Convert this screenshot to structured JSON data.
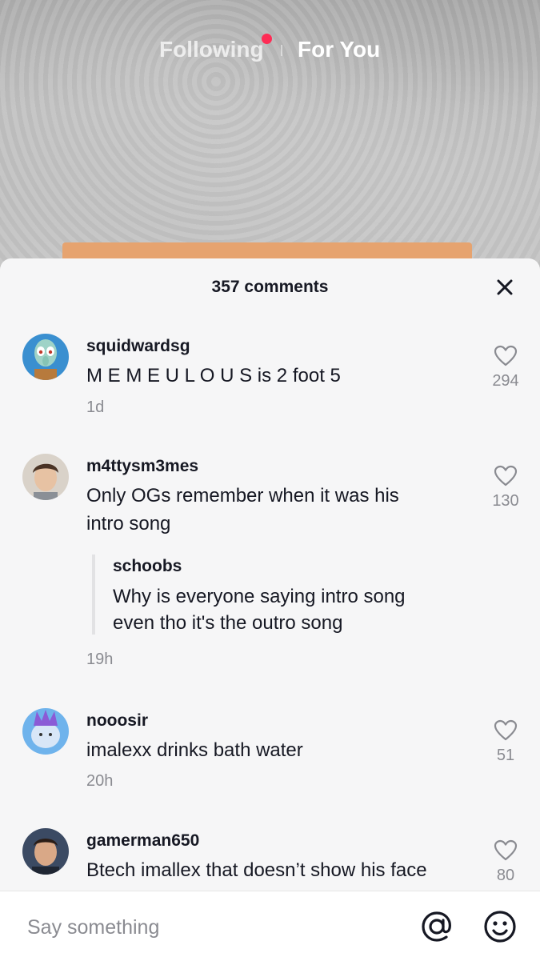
{
  "top_nav": {
    "following_label": "Following",
    "for_you_label": "For You",
    "live_dot_color": "#fe2c55"
  },
  "sheet": {
    "title": "357 comments",
    "close_icon": "close-icon"
  },
  "comments": [
    {
      "username": "squidwardsg",
      "text": "M E M E U L O U S is 2 foot 5",
      "time": "1d",
      "likes": "294",
      "avatar": "squidward-avatar"
    },
    {
      "username": "m4ttysm3mes",
      "text": "Only OGs remember when it was his intro song",
      "time": "19h",
      "likes": "130",
      "avatar": "user-photo-avatar",
      "reply": {
        "username": "schoobs",
        "text": "Why is everyone saying intro song even tho it's the outro song"
      }
    },
    {
      "username": "nooosir",
      "text": "imalexx drinks bath water",
      "time": "20h",
      "likes": "51",
      "avatar": "cartoon-avatar"
    },
    {
      "username": "gamerman650",
      "text": "Btech imallex that doesn’t show his face",
      "likes": "80",
      "avatar": "user-photo-avatar"
    }
  ],
  "input_bar": {
    "placeholder": "Say something",
    "mention_icon": "at-icon",
    "emoji_icon": "emoji-icon"
  }
}
